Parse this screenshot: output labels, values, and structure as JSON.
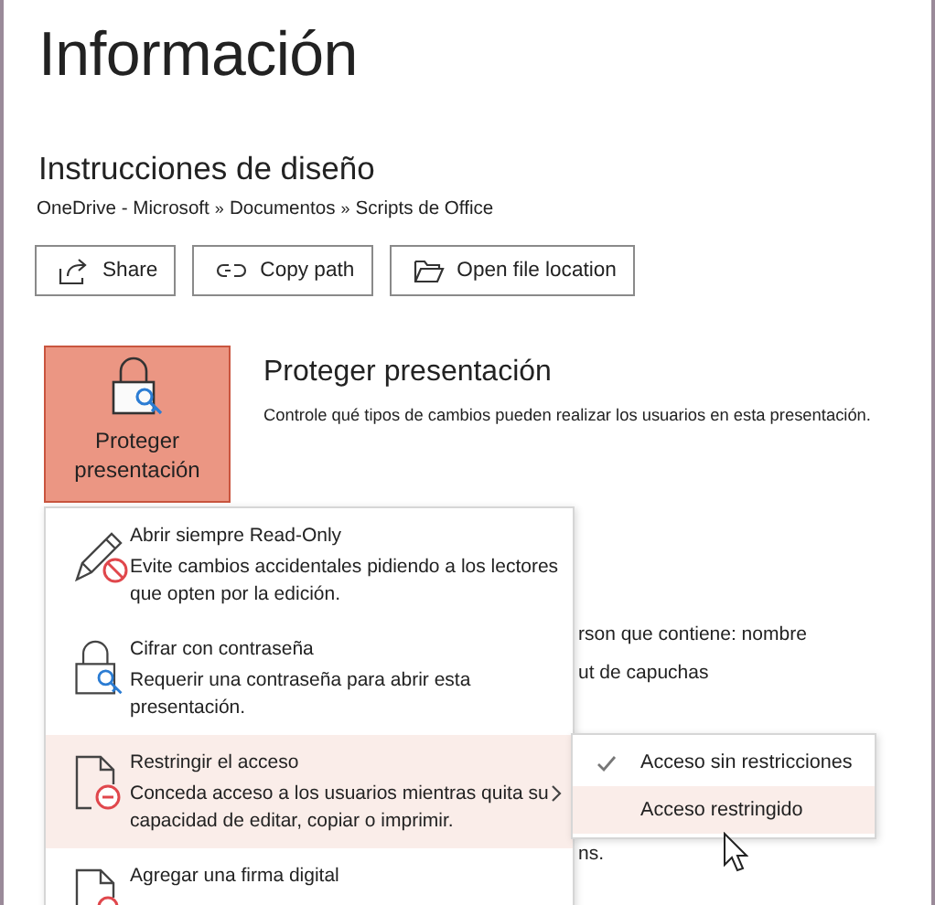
{
  "page_title": "Información",
  "document": {
    "name": "Instrucciones de diseño",
    "breadcrumb": [
      "OneDrive - Microsoft",
      "Documentos",
      "Scripts de Office"
    ],
    "separator": "»"
  },
  "actions": [
    {
      "label": "Share",
      "kind": "share"
    },
    {
      "label": "Copy path",
      "kind": "link"
    },
    {
      "label": "Open file location",
      "kind": "folder"
    }
  ],
  "protect": {
    "button_label": "Proteger presentación",
    "heading": "Proteger presentación",
    "description": "Controle qué tipos de cambios pueden realizar los usuarios en esta presentación.",
    "open": true
  },
  "covered_text": [
    "rson que contiene: nombre",
    "ut de capuchas",
    "ns."
  ],
  "menu": [
    {
      "kind": "readonly",
      "title": "Abrir siempre Read-Only",
      "description": "Evite cambios accidentales pidiendo a los lectores que opten por la edición.",
      "selected": false,
      "submenu": false
    },
    {
      "kind": "encrypt",
      "title": "Cifrar con contraseña",
      "description": "Requerir una contraseña para abrir esta presentación.",
      "selected": false,
      "submenu": false
    },
    {
      "kind": "restrict",
      "title": "Restringir el acceso",
      "description": "Conceda acceso a los usuarios mientras quita su capacidad de editar, copiar o imprimir.",
      "selected": true,
      "submenu": true
    },
    {
      "kind": "signature",
      "title": "Agregar una firma digital",
      "selected": false,
      "submenu": false
    }
  ],
  "submenu": [
    {
      "label": "Acceso sin restricciones",
      "checked": true,
      "selected": false
    },
    {
      "label": "Acceso restringido",
      "checked": false,
      "selected": true
    }
  ]
}
